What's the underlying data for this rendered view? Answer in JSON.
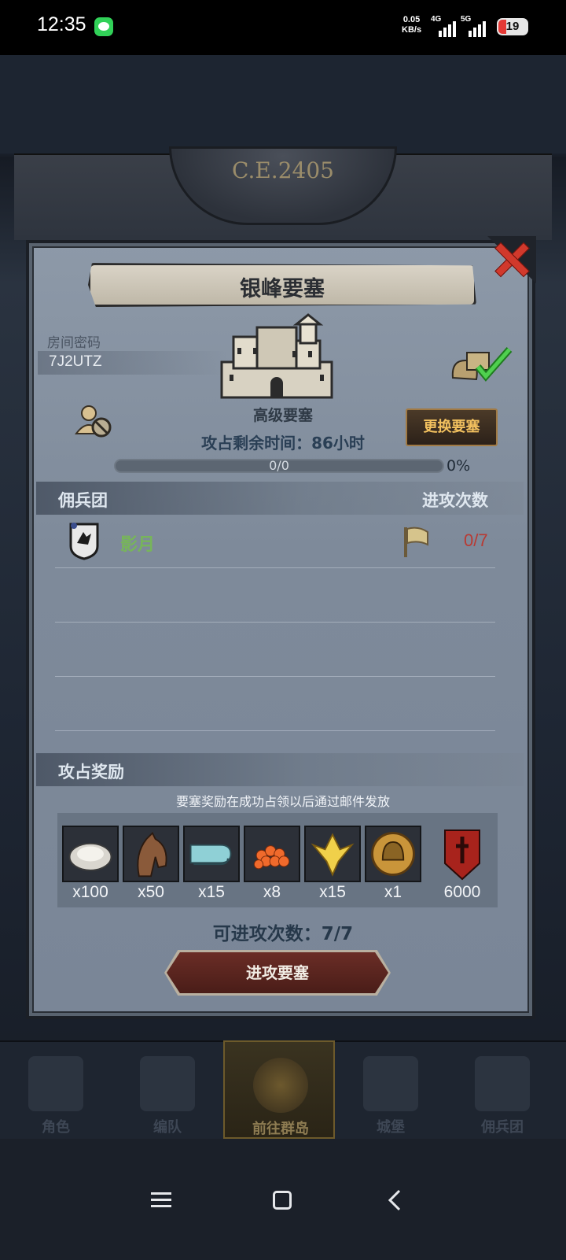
{
  "status_bar": {
    "time": "12:35",
    "net_speed": "0.05",
    "net_unit": "KB/s",
    "sig1": "4G",
    "sig2": "5G",
    "battery": "19"
  },
  "map": {
    "year_label": "C.E.2405"
  },
  "dialog": {
    "title": "银峰要塞",
    "room_label": "房间密码",
    "room_code": "7J2UTZ",
    "fort_type": "高级要塞",
    "change_button": "更换要塞",
    "remaining_time": "攻占剩余时间：86小时",
    "progress_text": "0/0",
    "progress_percent": "0%",
    "progress_fraction": 0,
    "section_left": "佣兵团",
    "section_right": "进攻次数",
    "guild_name": "影月",
    "guild_attacks": "0/7",
    "reward_title": "攻占奖励",
    "reward_note": "要塞奖励在成功占领以后通过邮件发放",
    "rewards": [
      {
        "icon": "oyster-icon",
        "qty": "x100"
      },
      {
        "icon": "horse-icon",
        "qty": "x50"
      },
      {
        "icon": "cloth-icon",
        "qty": "x15"
      },
      {
        "icon": "roe-icon",
        "qty": "x8"
      },
      {
        "icon": "golden-crest-icon",
        "qty": "x15"
      },
      {
        "icon": "helmet-coin-icon",
        "qty": "x1"
      },
      {
        "icon": "red-banner-icon",
        "qty": "6000"
      }
    ],
    "remaining_attacks": "可进攻次数：7/7",
    "attack_button": "进攻要塞"
  },
  "bottom_nav": [
    {
      "label": "角色"
    },
    {
      "label": "编队"
    },
    {
      "label": "前往群岛"
    },
    {
      "label": "城堡"
    },
    {
      "label": "佣兵团"
    }
  ],
  "colors": {
    "guild_name": "#77b55a",
    "attack_count": "#b83a33",
    "change_button_text": "#f2c15f",
    "close_x": "#d1392c"
  }
}
